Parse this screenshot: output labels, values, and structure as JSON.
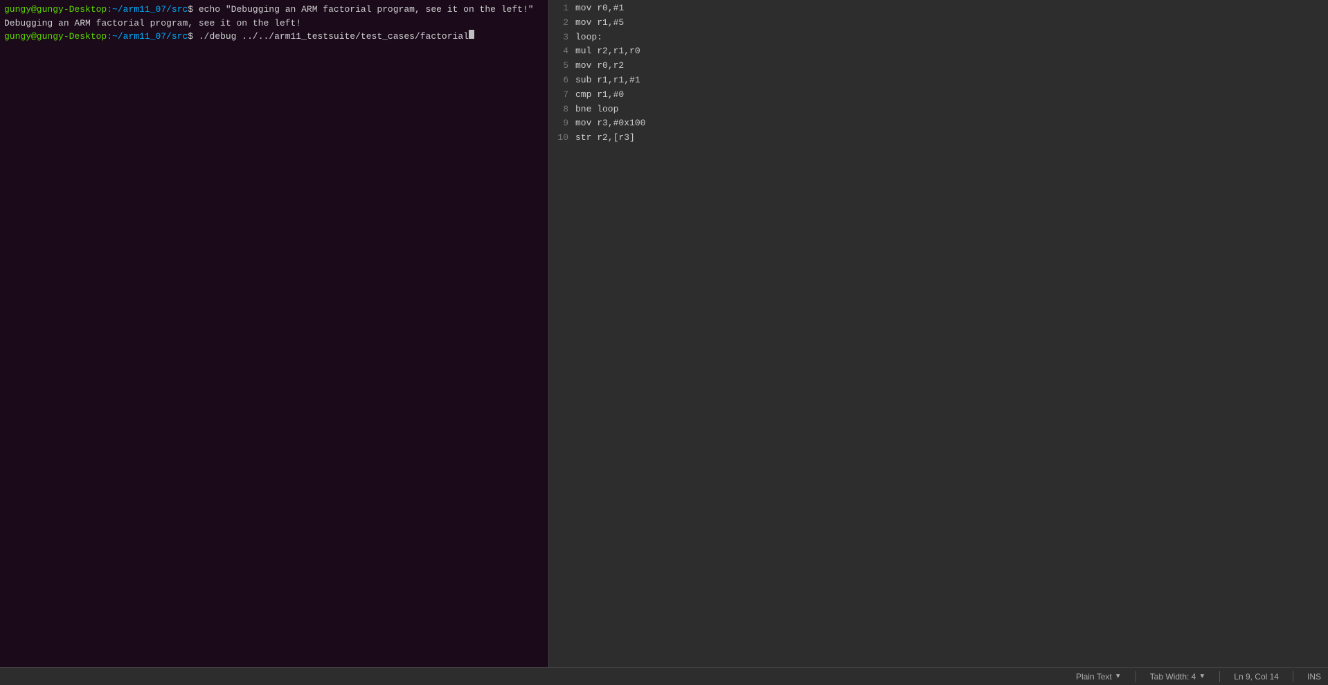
{
  "terminal": {
    "lines": [
      {
        "type": "command",
        "prompt_user": "gungy@gungy-Desktop",
        "prompt_path": ":~/arm11_07/src",
        "prompt_dollar": "$ ",
        "command": "echo \"Debugging an ARM factorial program, see it on the left!\""
      },
      {
        "type": "output",
        "text": "Debugging an ARM factorial program, see it on the left!"
      },
      {
        "type": "command_cursor",
        "prompt_user": "gungy@gungy-Desktop",
        "prompt_path": ":~/arm11_07/src",
        "prompt_dollar": "$ ",
        "command": "./debug ../../arm11_testsuite/test_cases/factorial"
      }
    ]
  },
  "editor": {
    "lines": [
      {
        "number": "1",
        "content": "mov r0,#1"
      },
      {
        "number": "2",
        "content": "mov r1,#5"
      },
      {
        "number": "3",
        "content": "loop:"
      },
      {
        "number": "4",
        "content": "mul r2,r1,r0"
      },
      {
        "number": "5",
        "content": "mov r0,r2"
      },
      {
        "number": "6",
        "content": "sub r1,r1,#1"
      },
      {
        "number": "7",
        "content": "cmp r1,#0"
      },
      {
        "number": "8",
        "content": "bne loop"
      },
      {
        "number": "9",
        "content": "mov r3,#0x100"
      },
      {
        "number": "10",
        "content": "str r2,[r3]"
      }
    ]
  },
  "statusbar": {
    "language": "Plain Text",
    "language_chevron": "▼",
    "tab_width": "Tab Width: 4",
    "tab_width_chevron": "▼",
    "position": "Ln 9, Col 14",
    "ins": "INS"
  }
}
